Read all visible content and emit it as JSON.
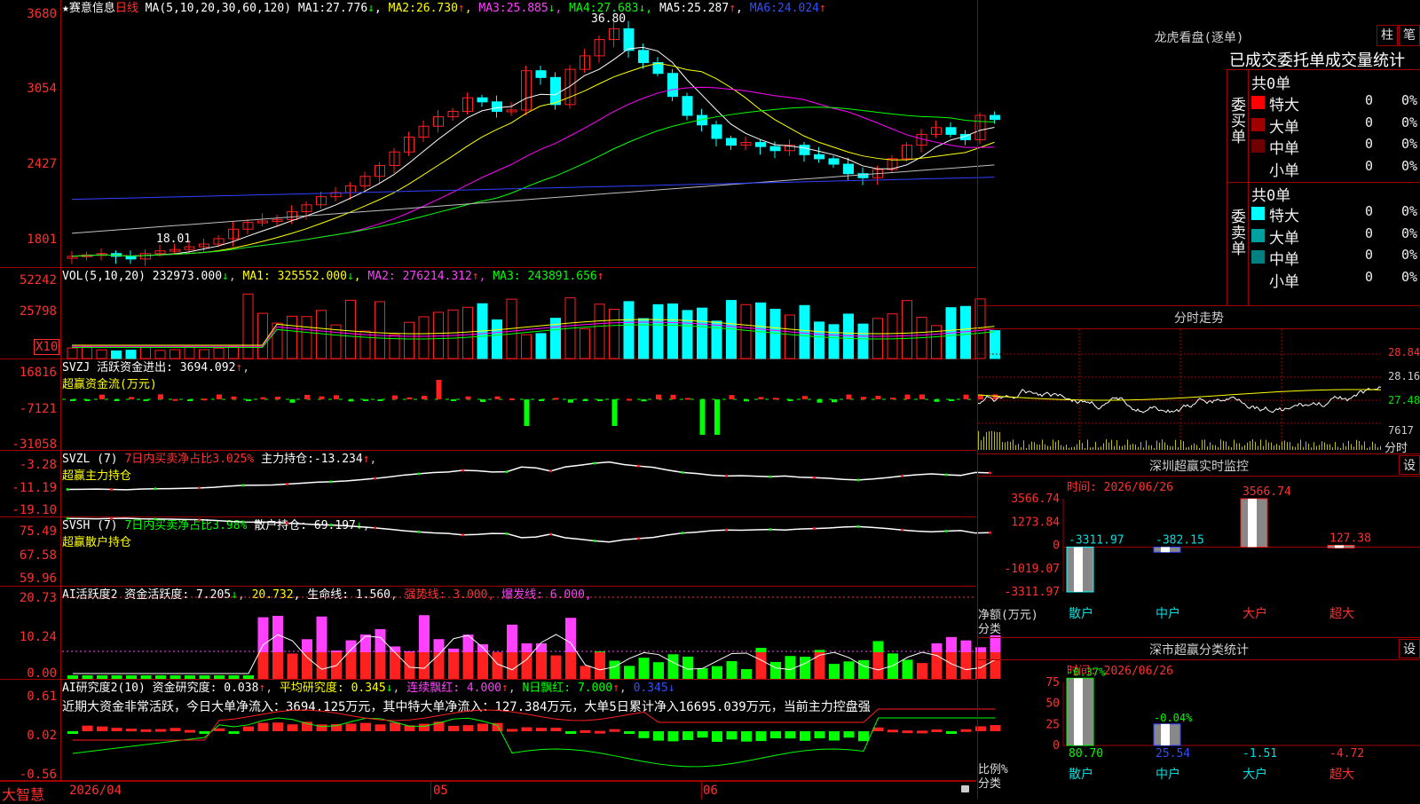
{
  "colors": {
    "up": "#ff2020",
    "down": "#00ffff",
    "grid": "#a00000",
    "ma1": "#ffffff",
    "ma2": "#ffff00",
    "ma3": "#ff00ff",
    "ma4": "#00ff00",
    "ma5": "#c0c0c0",
    "ma6": "#3040ff"
  },
  "main": {
    "title": "★赛意信息",
    "period": "日线",
    "ma_label": "MA(5,10,20,30,60,120)",
    "ma": [
      {
        "name": "MA1:",
        "value": "27.776",
        "arrow": "↓"
      },
      {
        "name": "MA2:",
        "value": "26.730",
        "arrow": "↑"
      },
      {
        "name": "MA3:",
        "value": "25.885",
        "arrow": "↓"
      },
      {
        "name": "MA4:",
        "value": "27.683",
        "arrow": "↓"
      },
      {
        "name": "MA5:",
        "value": "25.287",
        "arrow": "↑"
      },
      {
        "name": "MA6:",
        "value": "24.024",
        "arrow": "↑"
      }
    ],
    "y_labels": [
      "3680",
      "3054",
      "2427",
      "1801"
    ],
    "high_mark": "36.80",
    "low_mark": "18.01"
  },
  "vol": {
    "label": "VOL(5,10,20)",
    "value": "232973.000",
    "arrow": "↓",
    "ma": [
      {
        "name": "MA1:",
        "value": "325552.000",
        "arrow": "↓"
      },
      {
        "name": "MA2:",
        "value": "276214.312",
        "arrow": "↑"
      },
      {
        "name": "MA3:",
        "value": "243891.656",
        "arrow": "↑"
      }
    ],
    "y_labels": [
      "52242",
      "25798"
    ],
    "unit": "X10"
  },
  "svzj": {
    "label": "SVZJ",
    "name": "活跃资金进出:",
    "value": "3694.092",
    "arrow": "↑",
    "sub": "超赢资金流(万元)",
    "y_labels": [
      "16816",
      "-7121",
      "-31058"
    ]
  },
  "svzl": {
    "label": "SVZL (7)",
    "ratio": "7日内买卖净占比3.025%",
    "name": "主力持仓:",
    "value": "-13.234",
    "arrow": "↑",
    "sub": "超赢主力持仓",
    "y_labels": [
      "-3.28",
      "-11.19",
      "-19.10"
    ]
  },
  "svsh": {
    "label": "SVSH (7)",
    "ratio": "7日内买卖净占比3.98%",
    "name": "散户持仓:",
    "value": "69.197",
    "arrow": "↓",
    "sub": "超赢散户持仓",
    "y_labels": [
      "75.49",
      "67.58",
      "59.96"
    ]
  },
  "ai1": {
    "label": "AI活跃度2",
    "name1": "资金活跃度:",
    "v1": "7.205",
    "a1": "↓",
    "v2": "20.732",
    "a2": ",",
    "name3": "生命线:",
    "v3": "1.560",
    "name4": "强势线:",
    "v4": "3.000",
    "name5": "爆发线:",
    "v5": "6.000",
    "y_labels": [
      "20.73",
      "10.24",
      "0.00"
    ]
  },
  "ai2": {
    "label": "AI研究度2(10)",
    "name1": "资金研究度:",
    "v1": "0.038",
    "a1": "↑",
    "name2": "平均研究度:",
    "v2": "0.345",
    "a2": "↓",
    "name3": "连续飘红:",
    "v3": "4.000",
    "a3": "↑",
    "name4": "N日飘红:",
    "v4": "7.000",
    "a4": "↑",
    "v5": "0.345",
    "a5": "↓",
    "summary": "近期大资金非常活跃，今日大单净流入：3694.125万元，其中特大单净流入：127.384万元，大单5日累计净入16695.039万元，当前主力控盘强",
    "y_labels": [
      "0.61",
      "0.02",
      "-0.56"
    ]
  },
  "xaxis": {
    "labels": [
      "2026/04",
      "05",
      "06"
    ]
  },
  "brand": "大智慧",
  "dragon": {
    "title": "龙虎看盘(逐单)",
    "btn1": "柱",
    "btn2": "笔",
    "subtitle": "已成交委托单成交量统计",
    "buy": {
      "side": "委买单",
      "total": "共0单",
      "rows": [
        {
          "label": "特大",
          "color": "#ff0000",
          "count": "0",
          "pct": "0%"
        },
        {
          "label": "大单",
          "color": "#a00000",
          "count": "0",
          "pct": "0%"
        },
        {
          "label": "中单",
          "color": "#700000",
          "count": "0",
          "pct": "0%"
        },
        {
          "label": "小单",
          "color": "",
          "count": "0",
          "pct": "0%"
        }
      ]
    },
    "sell": {
      "side": "委卖单",
      "total": "共0单",
      "rows": [
        {
          "label": "特大",
          "color": "#00ffff",
          "count": "0",
          "pct": "0%"
        },
        {
          "label": "大单",
          "color": "#00a0a0",
          "count": "0",
          "pct": "0%"
        },
        {
          "label": "中单",
          "color": "#008080",
          "count": "0",
          "pct": "0%"
        },
        {
          "label": "小单",
          "color": "",
          "count": "0",
          "pct": "0%"
        }
      ]
    }
  },
  "intraday": {
    "title": "分时走势",
    "y_labels": [
      "28.84",
      "28.16",
      "27.48"
    ],
    "vol_label": "7617",
    "time_label": "分时"
  },
  "sz_monitor": {
    "title": "深圳超赢实时监控",
    "btn": "设",
    "date": "时间: 2026/06/26",
    "y_labels": [
      "3566.74",
      "1273.84",
      "0",
      "-1019.07",
      "-3311.97"
    ],
    "ylabel": "净额(万元)",
    "xlabel": "分类",
    "cats": [
      "散户",
      "中户",
      "大户",
      "超大"
    ],
    "values": [
      -3311.97,
      -382.15,
      3566.74,
      127.38
    ],
    "value_labels": [
      "-3311.97",
      "-382.15",
      "3566.74",
      "127.38"
    ]
  },
  "sz_class": {
    "title": "深市超赢分类统计",
    "btn": "设",
    "date": "时间: 2026/06/26",
    "y_labels": [
      "75",
      "50",
      "25",
      "0"
    ],
    "ylabel": "比例%",
    "xlabel": "分类",
    "cats": [
      "散户",
      "中户",
      "大户",
      "超大"
    ],
    "values": [
      80.7,
      25.54,
      -1.51,
      -4.72
    ],
    "value_labels": [
      "80.70",
      "25.54",
      "-1.51",
      "-4.72"
    ],
    "top_labels": [
      "-0.37%",
      "-0.04%"
    ]
  }
}
